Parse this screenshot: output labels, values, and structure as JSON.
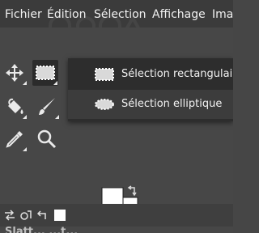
{
  "menubar": {
    "items": [
      {
        "label": "Fichier"
      },
      {
        "label": "Édition"
      },
      {
        "label": "Sélection"
      },
      {
        "label": "Affichage"
      },
      {
        "label": "Ima"
      }
    ]
  },
  "tools": [
    {
      "name": "move-tool"
    },
    {
      "name": "rect-select-tool",
      "active": true
    },
    {
      "name": "bucket-fill-tool"
    },
    {
      "name": "paintbrush-tool"
    },
    {
      "name": "color-picker-tool"
    },
    {
      "name": "zoom-tool"
    }
  ],
  "popup": {
    "items": [
      {
        "label": "Sélection rectangulaire",
        "icon": "rect-select-icon"
      },
      {
        "label": "Sélection elliptique",
        "icon": "ellipse-select-icon",
        "highlighted": true
      }
    ]
  },
  "colors": {
    "foreground": "#ffffff",
    "background": "#ffffff",
    "panel_bg": "#474747",
    "popup_bg": "#2d2d2d",
    "highlight_bg": "#3c3c3c"
  },
  "bottom_strip": {
    "partial_text": "Slatt... ...t..."
  }
}
